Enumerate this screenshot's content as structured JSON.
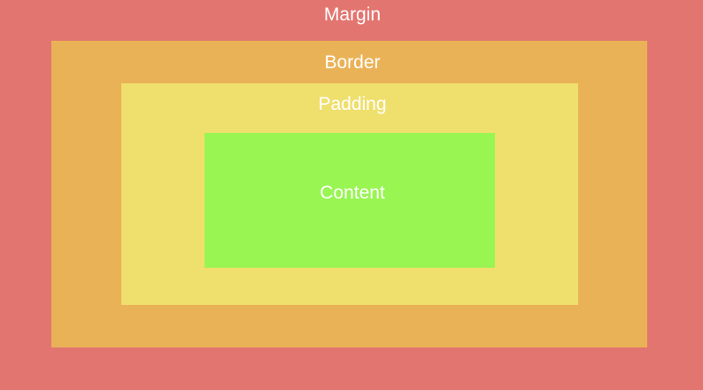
{
  "labels": {
    "margin": "Margin",
    "border": "Border",
    "padding": "Padding",
    "content": "Content"
  },
  "colors": {
    "margin": "#E37570",
    "border": "#EAB257",
    "padding": "#EFDF6C",
    "content": "#98F552",
    "text": "#FFFFFF"
  }
}
